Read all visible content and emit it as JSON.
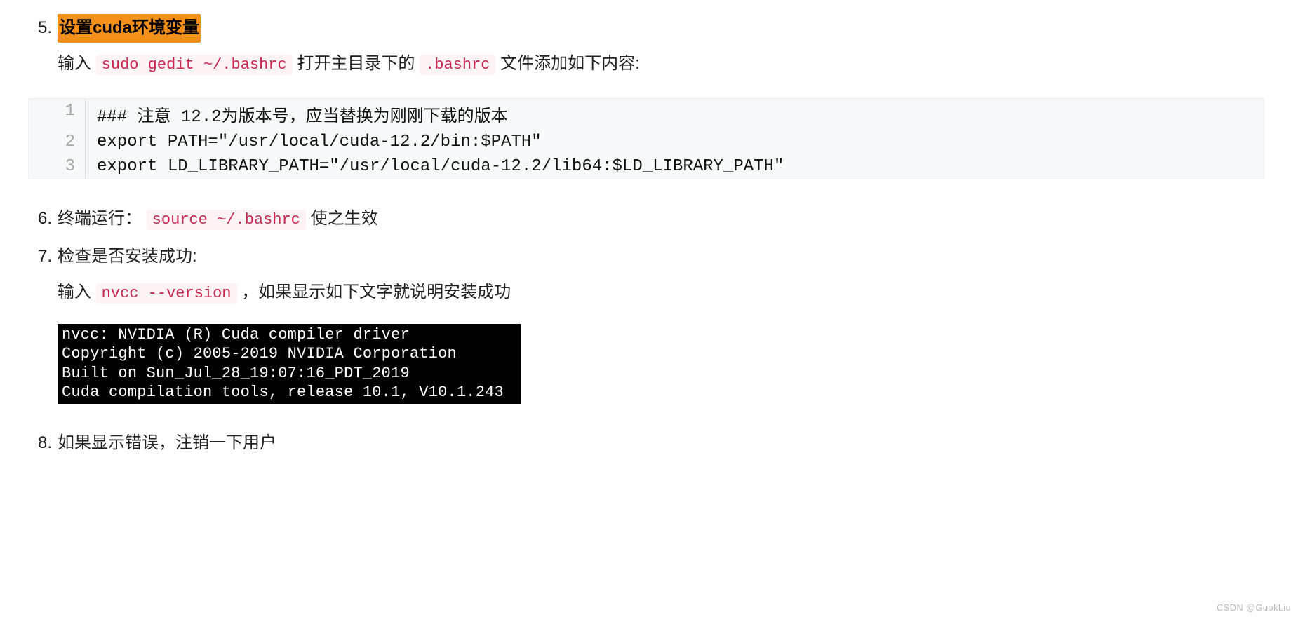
{
  "items": [
    {
      "num": "5.",
      "title": "设置cuda环境变量",
      "desc_prefix": "输入 ",
      "cmd": "sudo gedit ~/.bashrc",
      "desc_mid1": " 打开主目录下的  ",
      "file": ".bashrc",
      "desc_suffix": " 文件添加如下内容:"
    },
    {
      "num": "6.",
      "text_before": "终端运行： ",
      "cmd": "source ~/.bashrc",
      "text_after": " 使之生效"
    },
    {
      "num": "7.",
      "heading": "检查是否安装成功:",
      "sub_prefix": "输入 ",
      "cmd": "nvcc --version",
      "sub_suffix": " ，如果显示如下文字就说明安装成功"
    },
    {
      "num": "8.",
      "text": "如果显示错误，注销一下用户"
    }
  ],
  "code_lines": [
    {
      "n": "1",
      "c": "### 注意 12.2为版本号，应当替换为刚刚下载的版本"
    },
    {
      "n": "2",
      "c": "export PATH=\"/usr/local/cuda-12.2/bin:$PATH\""
    },
    {
      "n": "3",
      "c": "export LD_LIBRARY_PATH=\"/usr/local/cuda-12.2/lib64:$LD_LIBRARY_PATH\""
    }
  ],
  "terminal_lines": [
    "nvcc: NVIDIA (R) Cuda compiler driver",
    "Copyright (c) 2005-2019 NVIDIA Corporation",
    "Built on Sun_Jul_28_19:07:16_PDT_2019",
    "Cuda compilation tools, release 10.1, V10.1.243"
  ],
  "watermark": "CSDN @GuokLiu"
}
